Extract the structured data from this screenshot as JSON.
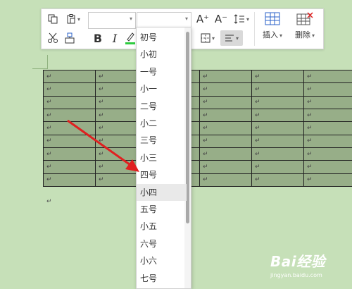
{
  "toolbar": {
    "bold": "B",
    "italic": "I",
    "font_grow": "A⁺",
    "font_shrink": "A⁻",
    "line_spacing": "↕",
    "insert_label": "插入",
    "delete_label": "删除",
    "caret": "▾"
  },
  "font_size_menu": {
    "items": [
      "初号",
      "小初",
      "一号",
      "小一",
      "二号",
      "小二",
      "三号",
      "小三",
      "四号",
      "小四",
      "五号",
      "小五",
      "六号",
      "小六",
      "七号"
    ],
    "selected_index": 9,
    "selected": "小四"
  },
  "table": {
    "rows": 9,
    "cols": 6,
    "cell_mark": "↵"
  },
  "paragraph_mark": "↵",
  "watermark": {
    "brand": "Bai经验",
    "url": "jingyan.baidu.com"
  },
  "colors": {
    "background": "#c6e0b8",
    "table_fill": "#97ae88",
    "arrow": "#e02020",
    "highlight_underline": "#2ecc40",
    "font_color_underline": "#e02020"
  }
}
